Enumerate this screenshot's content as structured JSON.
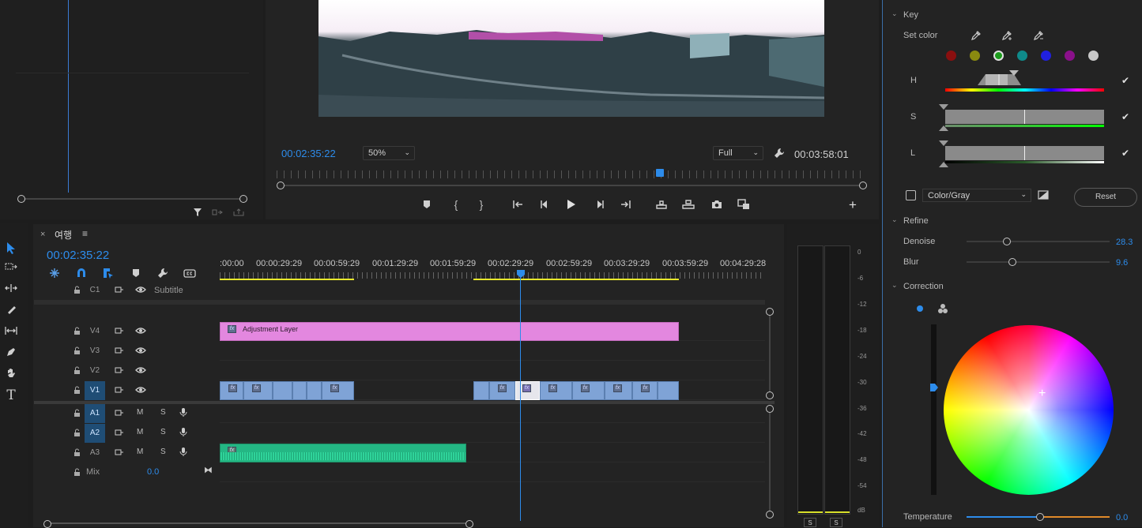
{
  "source_monitor": {},
  "program_monitor": {
    "timecode": "00:02:35:22",
    "zoom": "50%",
    "quality": "Full",
    "duration": "00:03:58:01"
  },
  "timeline": {
    "sequence_name": "여행",
    "timecode": "00:02:35:22",
    "ruler_labels": [
      ":00:00",
      "00:00:29:29",
      "00:00:59:29",
      "00:01:29:29",
      "00:01:59:29",
      "00:02:29:29",
      "00:02:59:29",
      "00:03:29:29",
      "00:03:59:29",
      "00:04:29:28"
    ],
    "tracks": {
      "c1": {
        "name": "C1",
        "label": "Subtitle"
      },
      "v4": {
        "name": "V4"
      },
      "v3": {
        "name": "V3"
      },
      "v2": {
        "name": "V2"
      },
      "v1": {
        "name": "V1"
      },
      "a1": {
        "name": "A1",
        "m": "M",
        "s": "S"
      },
      "a2": {
        "name": "A2",
        "m": "M",
        "s": "S"
      },
      "a3": {
        "name": "A3",
        "m": "M",
        "s": "S"
      },
      "mix": {
        "label": "Mix",
        "value": "0.0"
      }
    },
    "adjustment_clip": "Adjustment Layer",
    "fx_label": "fx"
  },
  "audio_meter": {
    "scale": [
      "0",
      "-6",
      "-12",
      "-18",
      "-24",
      "-30",
      "-36",
      "-42",
      "-48",
      "-54",
      "dB"
    ],
    "solo_left": "S",
    "solo_right": "S"
  },
  "lumetri": {
    "key_section": "Key",
    "set_color_label": "Set color",
    "swatch_colors": [
      "#8a0f0f",
      "#8a8a10",
      "#1c9c1c",
      "#0f8a8a",
      "#2020e0",
      "#8a108a",
      "#c8c8c8"
    ],
    "h_label": "H",
    "s_label": "S",
    "l_label": "L",
    "color_gray_select": "Color/Gray",
    "reset_label": "Reset",
    "refine_section": "Refine",
    "denoise_label": "Denoise",
    "denoise_value": "28.3",
    "blur_label": "Blur",
    "blur_value": "9.6",
    "correction_section": "Correction",
    "temperature_label": "Temperature",
    "temperature_value": "0.0"
  }
}
